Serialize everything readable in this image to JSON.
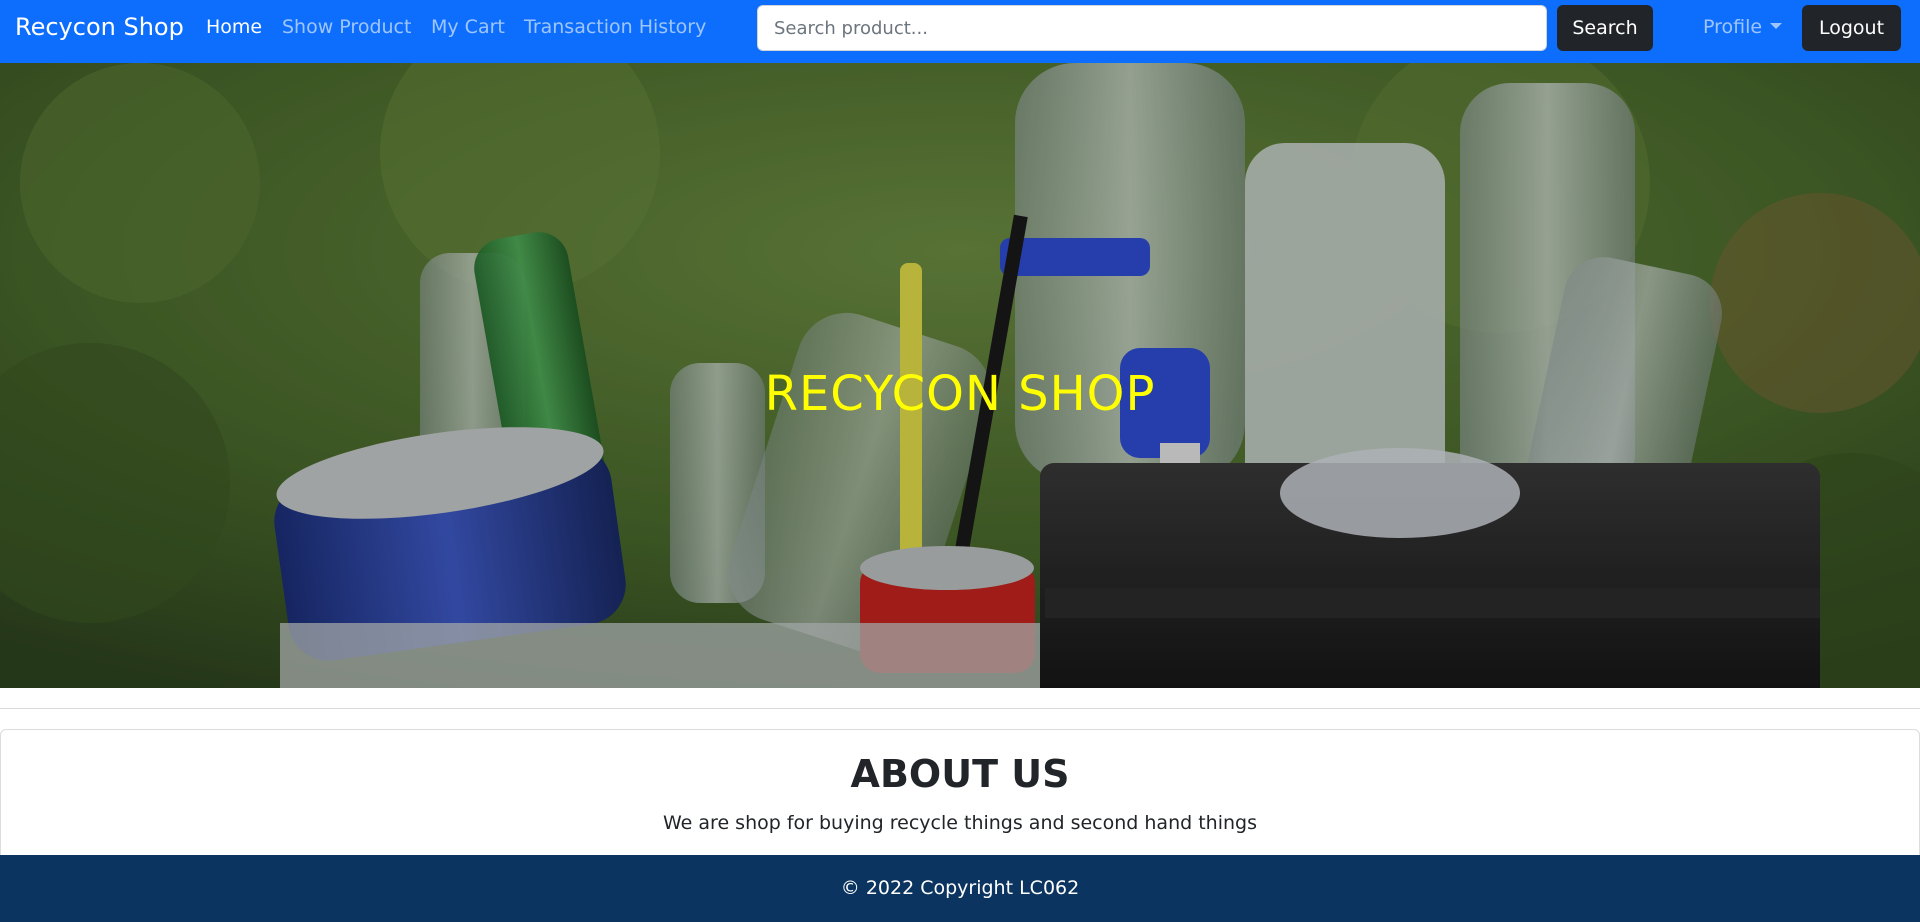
{
  "navbar": {
    "brand": "Recycon Shop",
    "links": [
      {
        "label": "Home",
        "active": true
      },
      {
        "label": "Show Product",
        "active": false
      },
      {
        "label": "My Cart",
        "active": false
      },
      {
        "label": "Transaction History",
        "active": false
      }
    ],
    "search": {
      "placeholder": "Search product...",
      "value": "",
      "button_label": "Search"
    },
    "profile_label": "Profile",
    "logout_label": "Logout",
    "bg_color": "#0d6efd"
  },
  "hero": {
    "title": "RECYCON SHOP",
    "title_color": "#ffff00"
  },
  "about": {
    "title": "ABOUT US",
    "text": "We are shop for buying recycle things and second hand things"
  },
  "footer": {
    "text": "© 2022 Copyright LC062",
    "bg_color": "#0b3560"
  }
}
